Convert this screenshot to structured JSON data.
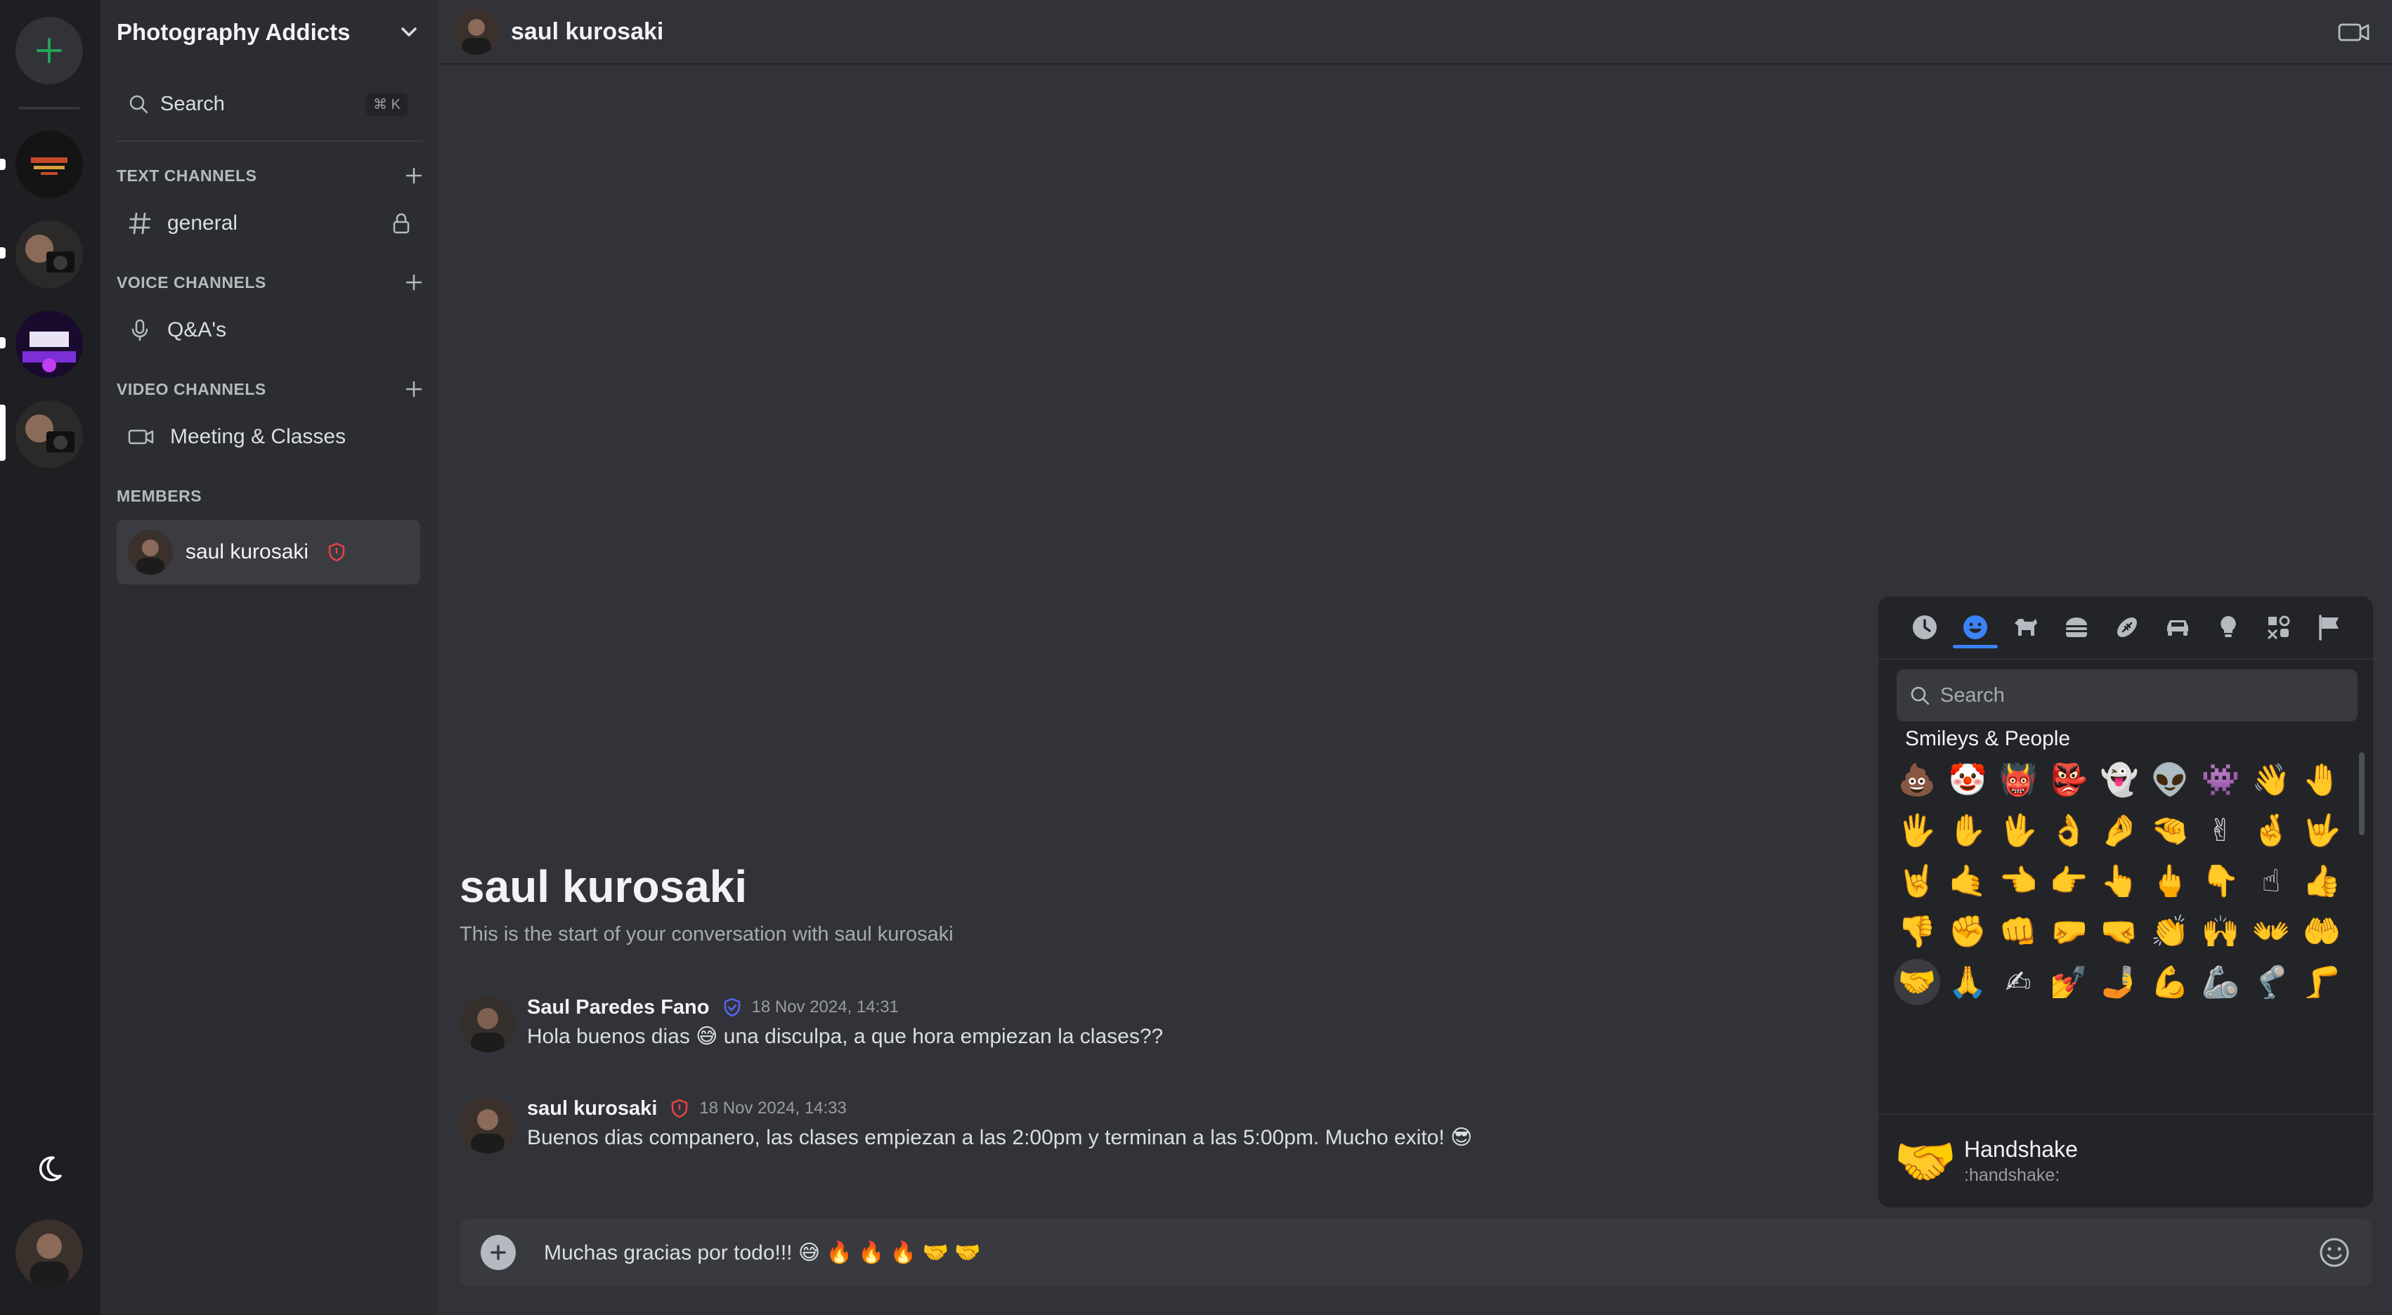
{
  "server": {
    "name": "Photography Addicts"
  },
  "sidebar": {
    "search_label": "Search",
    "search_shortcut": "⌘ K",
    "categories": {
      "text": "TEXT CHANNELS",
      "voice": "VOICE CHANNELS",
      "video": "VIDEO CHANNELS",
      "members": "MEMBERS"
    },
    "channels": {
      "general": "general",
      "qa": "Q&A's",
      "meeting": "Meeting & Classes"
    },
    "member_name": "saul kurosaki"
  },
  "topbar": {
    "title": "saul kurosaki"
  },
  "conversation": {
    "title": "saul kurosaki",
    "subtitle": "This is the start of your conversation with saul kurosaki",
    "messages": [
      {
        "author": "Saul Paredes Fano",
        "time": "18 Nov 2024, 14:31",
        "text": "Hola buenos dias 😅 una disculpa, a que hora empiezan la clases??",
        "badge_color": "#5865f2"
      },
      {
        "author": "saul kurosaki",
        "time": "18 Nov 2024, 14:33",
        "text": "Buenos dias companero, las clases empiezan a las 2:00pm y terminan a las 5:00pm. Mucho exito! 😎",
        "badge_color": "#ed4245"
      }
    ]
  },
  "composer": {
    "value": "Muchas gracias por todo!!!  😅 🔥 🔥 🔥 🤝 🤝"
  },
  "emoji_picker": {
    "search_placeholder": "Search",
    "section_title": "Smileys & People",
    "emojis": [
      "💩",
      "🤡",
      "👹",
      "👺",
      "👻",
      "👽",
      "👾",
      "👋",
      "🤚",
      "🖐",
      "✋",
      "🖖",
      "👌",
      "🤌",
      "🤏",
      "✌",
      "🤞",
      "🤟",
      "🤘",
      "🤙",
      "👈",
      "👉",
      "👆",
      "🖕",
      "👇",
      "☝",
      "👍",
      "👎",
      "✊",
      "👊",
      "🤛",
      "🤜",
      "👏",
      "🙌",
      "👐",
      "🤲",
      "🤝",
      "🙏",
      "✍",
      "💅",
      "🤳",
      "💪",
      "🦾",
      "🦿",
      "🦵",
      "🦶",
      "👂",
      "🦻",
      "👃",
      "🧠",
      "🫀",
      "🫁",
      "🦷",
      "🦴",
      "👀",
      "👁",
      "👅",
      "👄",
      "👶",
      "🧒",
      "👦",
      "👧",
      "🧑"
    ],
    "selected_index": 36,
    "preview_emoji": "🤝",
    "preview_name": "Handshake",
    "preview_code": ":handshake:"
  },
  "colors": {
    "accent": "#3b82f6",
    "add_green": "#23a55a",
    "owner_red": "#ed4245"
  }
}
